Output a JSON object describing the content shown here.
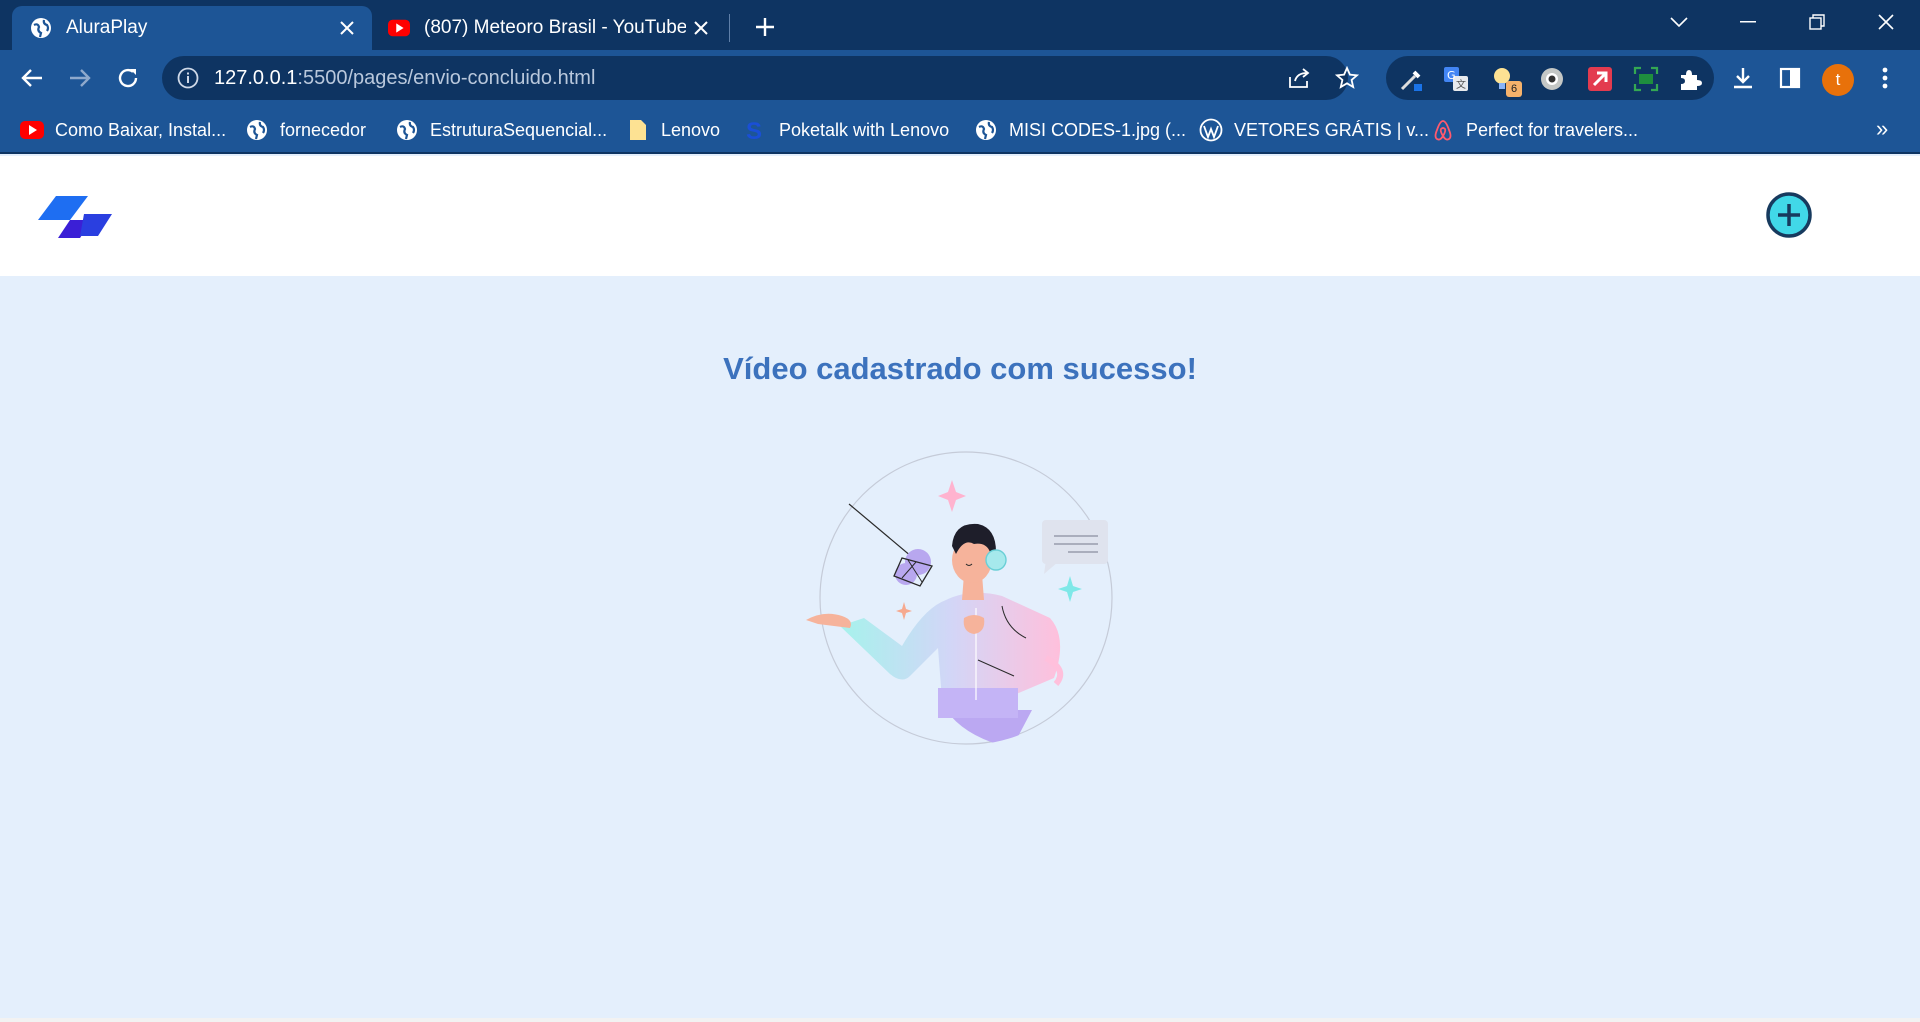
{
  "browser": {
    "tabs": [
      {
        "title": "AluraPlay",
        "icon": "globe-icon",
        "active": true
      },
      {
        "title": "(807) Meteoro Brasil - YouTube",
        "icon": "youtube-icon",
        "active": false
      }
    ],
    "address": {
      "host": "127.0.0.1",
      "path": ":5500/pages/envio-concluido.html"
    },
    "profile_initial": "t",
    "extension_badge": "6",
    "bookmarks": [
      {
        "label": "Como Baixar, Instal...",
        "icon": "youtube-icon"
      },
      {
        "label": "fornecedor",
        "icon": "globe-icon"
      },
      {
        "label": "EstruturaSequencial...",
        "icon": "globe-icon"
      },
      {
        "label": "Lenovo",
        "icon": "folder-icon"
      },
      {
        "label": "Poketalk with Lenovo",
        "icon": "poketalk-icon"
      },
      {
        "label": "MISI CODES-1.jpg (...",
        "icon": "globe-icon"
      },
      {
        "label": "VETORES GRÁTIS | v...",
        "icon": "wordpress-icon"
      },
      {
        "label": "Perfect for travelers...",
        "icon": "airbnb-icon"
      }
    ],
    "bookmarks_overflow": "»"
  },
  "page": {
    "success_message": "Vídeo cadastrado com sucesso!"
  },
  "colors": {
    "chrome_dark": "#0e3462",
    "chrome_mid": "#1d5596",
    "page_bg": "#e4effc",
    "title_blue": "#3c72bd",
    "add_button_fill": "#41d8e8"
  }
}
